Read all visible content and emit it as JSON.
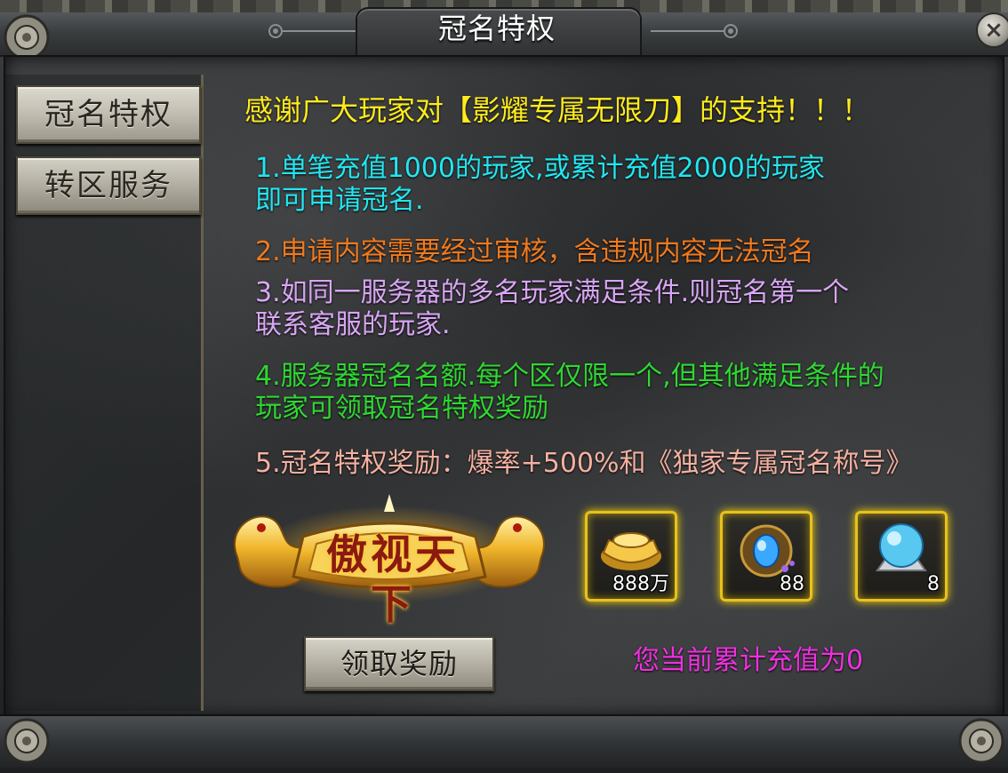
{
  "window": {
    "title": "冠名特权",
    "close_icon": "×"
  },
  "sidebar": {
    "items": [
      {
        "label": "冠名特权",
        "active": true
      },
      {
        "label": "转区服务",
        "active": false
      }
    ]
  },
  "content": {
    "headline": "感谢广大玩家对【影耀专属无限刀】的支持！！！",
    "rule1_line1": "1.单笔充值1000的玩家,或累计充值2000的玩家",
    "rule1_line2": "即可申请冠名.",
    "rule2": "2.申请内容需要经过审核，含违规内容无法冠名",
    "rule3_line1": "3.如同一服务器的多名玩家满足条件.则冠名第一个",
    "rule3_line2": "联系客服的玩家.",
    "rule4_line1": "4.服务器冠名名额.每个区仅限一个,但其他满足条件的",
    "rule4_line2": "玩家可领取冠名特权奖励",
    "rule5": "5.冠名特权奖励：爆率+500%和《独家专属冠名称号》",
    "emblem_text": "傲视天下",
    "claim_button": "领取奖励",
    "recharge_status": "您当前累计充值为0"
  },
  "rewards": [
    {
      "icon": "gold-ingot-icon",
      "count": "888万"
    },
    {
      "icon": "blue-gem-icon",
      "count": "88"
    },
    {
      "icon": "crystal-orb-icon",
      "count": "8"
    }
  ],
  "colors": {
    "headline": "#ffeb1e",
    "rule1": "#22e6f0",
    "rule2": "#f07a1e",
    "rule3": "#d9a6f5",
    "rule4": "#2fd832",
    "rule5": "#f4b0a0",
    "status": "#f030e0",
    "reward_border": "#e8c11e"
  }
}
